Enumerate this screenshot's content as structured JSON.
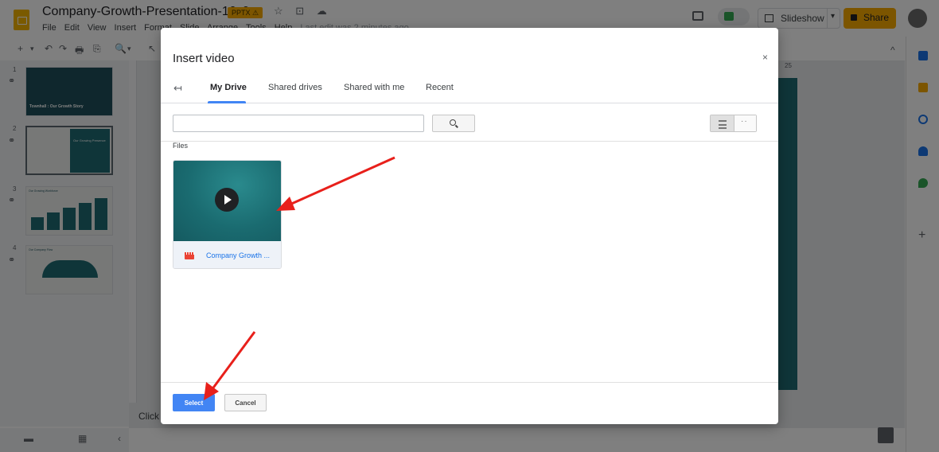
{
  "header": {
    "doc_title": "Company-Growth-Presentation-16x9",
    "badge": "PPTX ⚠",
    "title_icons": "☆ ⊡ ☁",
    "menu": [
      "File",
      "Edit",
      "View",
      "Insert",
      "Format",
      "Slide",
      "Arrange",
      "Tools",
      "Help"
    ],
    "menu_faded": "Last edit was 2 minutes ago",
    "slideshow_label": "Slideshow",
    "share_label": "Share"
  },
  "toolbar": {
    "icons": [
      "+",
      "▾",
      "↶",
      "↷",
      "🖶",
      "⎘",
      "🔍",
      "▾",
      "↖"
    ]
  },
  "filmstrip": {
    "slides": [
      {
        "num": "1",
        "thumb_text": "Townhall : Our Growth Story"
      },
      {
        "num": "2",
        "thumb_text": "Our Growing Presence"
      },
      {
        "num": "3",
        "thumb_text": "Our Growing Workforce"
      },
      {
        "num": "4",
        "thumb_text": "Our Company Flow"
      }
    ],
    "link_icon": "⚭"
  },
  "canvas": {
    "ruler_top_num": "25",
    "click_hint": "Click"
  },
  "modal": {
    "title": "Insert video",
    "close": "×",
    "back": "↤",
    "tabs": [
      {
        "label": "My Drive",
        "active": true
      },
      {
        "label": "Shared drives",
        "active": false
      },
      {
        "label": "Shared with me",
        "active": false
      },
      {
        "label": "Recent",
        "active": false
      }
    ],
    "search": {
      "value": "",
      "placeholder": ""
    },
    "files_label": "Files",
    "files": [
      {
        "name": "Company Growth ...",
        "type": "video"
      }
    ],
    "select_label": "Select",
    "cancel_label": "Cancel"
  },
  "left_bottom": {
    "icons": [
      "▬",
      "▦",
      "‹"
    ]
  },
  "colors": {
    "accent": "#4285f4",
    "brand_yellow": "#f9ab00",
    "teal": "#1e6a72",
    "arrow": "#e8201b"
  }
}
